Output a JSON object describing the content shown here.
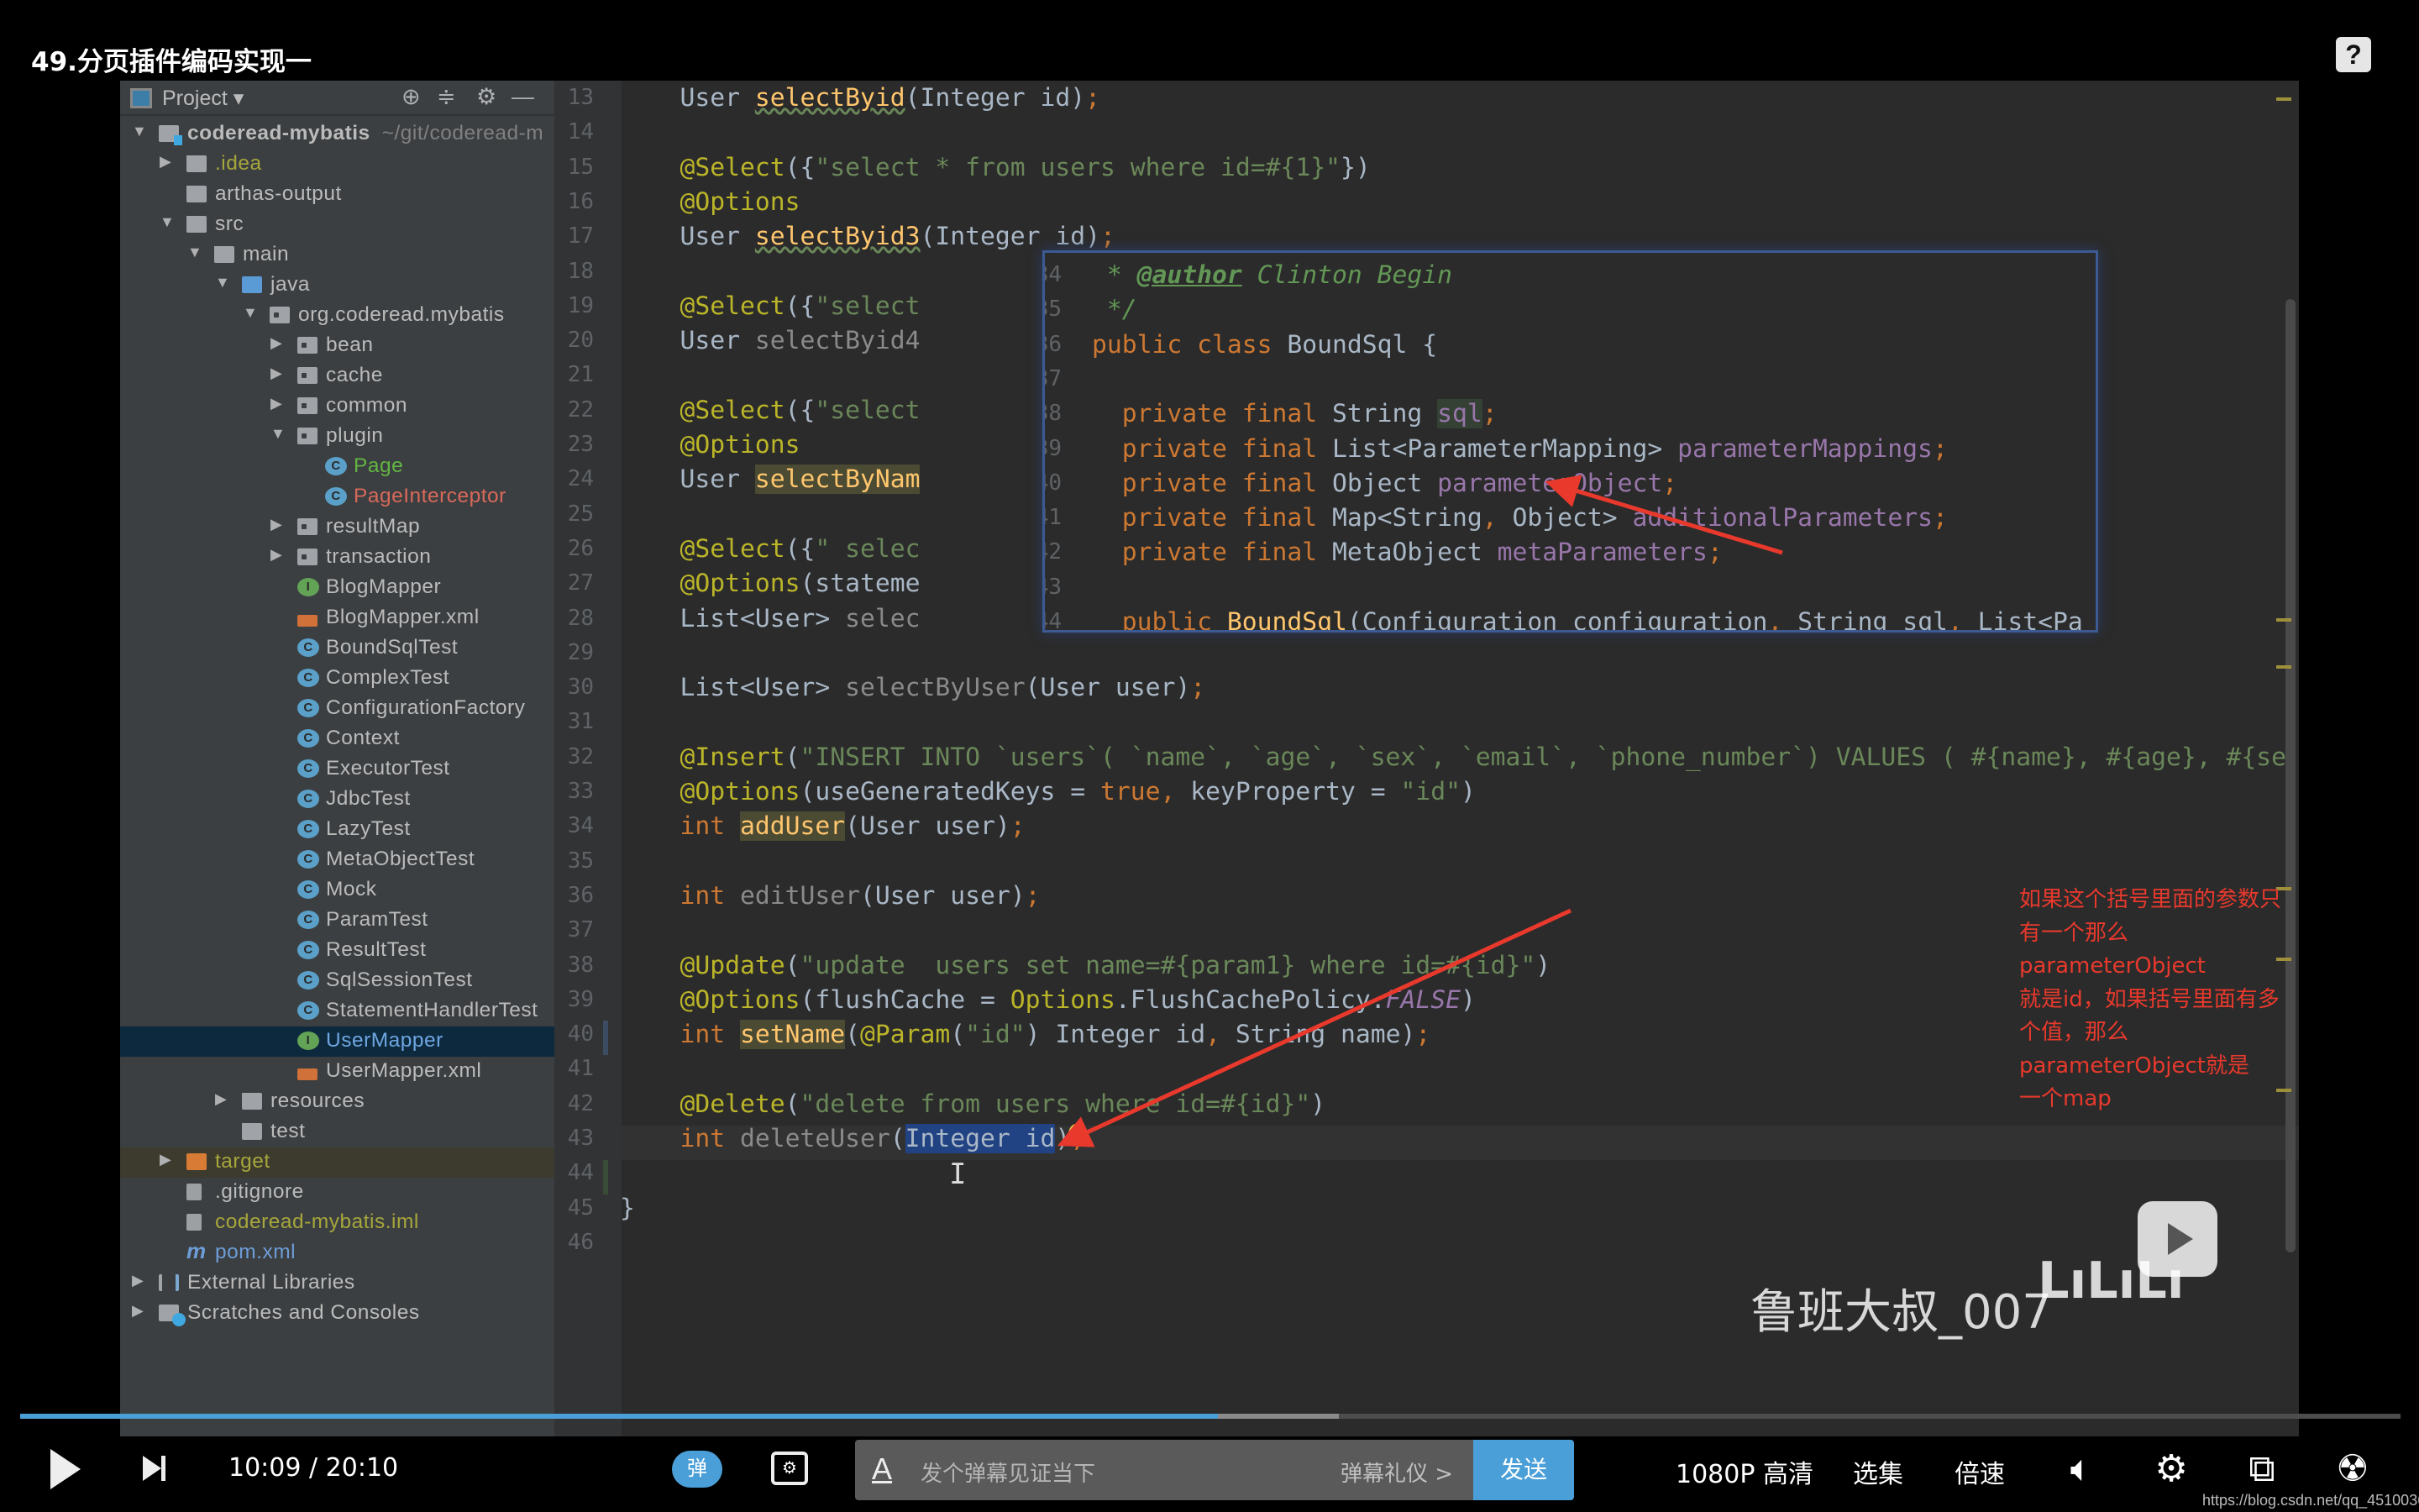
{
  "video_title": "49.分页插件编码实现一",
  "help_icon": "?",
  "sidebar": {
    "header": "Project",
    "header_icons": [
      "locate-icon",
      "collapse-icon",
      "gear-icon",
      "minimize-icon"
    ],
    "items": [
      {
        "label": "coderead-mybatis",
        "hint": "~/git/coderead-m",
        "level": 0,
        "arrow": "down",
        "icon": "module",
        "bold": true
      },
      {
        "label": ".idea",
        "level": 1,
        "arrow": "right",
        "icon": "folder",
        "color": "#a6a63c"
      },
      {
        "label": "arthas-output",
        "level": 1,
        "arrow": "",
        "icon": "folder"
      },
      {
        "label": "src",
        "level": 1,
        "arrow": "down",
        "icon": "folder"
      },
      {
        "label": "main",
        "level": 2,
        "arrow": "down",
        "icon": "folder"
      },
      {
        "label": "java",
        "level": 3,
        "arrow": "down",
        "icon": "folder-blue"
      },
      {
        "label": "org.coderead.mybatis",
        "level": 4,
        "arrow": "down",
        "icon": "package"
      },
      {
        "label": "bean",
        "level": 5,
        "arrow": "right",
        "icon": "package"
      },
      {
        "label": "cache",
        "level": 5,
        "arrow": "right",
        "icon": "package"
      },
      {
        "label": "common",
        "level": 5,
        "arrow": "right",
        "icon": "package"
      },
      {
        "label": "plugin",
        "level": 5,
        "arrow": "down",
        "icon": "package"
      },
      {
        "label": "Page",
        "level": 6,
        "arrow": "",
        "icon": "class",
        "color": "#62b543"
      },
      {
        "label": "PageInterceptor",
        "level": 6,
        "arrow": "",
        "icon": "class",
        "color": "#d8695a"
      },
      {
        "label": "resultMap",
        "level": 5,
        "arrow": "right",
        "icon": "package"
      },
      {
        "label": "transaction",
        "level": 5,
        "arrow": "right",
        "icon": "package"
      },
      {
        "label": "BlogMapper",
        "level": 5,
        "arrow": "",
        "icon": "iface"
      },
      {
        "label": "BlogMapper.xml",
        "level": 5,
        "arrow": "",
        "icon": "xml"
      },
      {
        "label": "BoundSqlTest",
        "level": 5,
        "arrow": "",
        "icon": "test"
      },
      {
        "label": "ComplexTest",
        "level": 5,
        "arrow": "",
        "icon": "test"
      },
      {
        "label": "ConfigurationFactory",
        "level": 5,
        "arrow": "",
        "icon": "class"
      },
      {
        "label": "Context",
        "level": 5,
        "arrow": "",
        "icon": "test"
      },
      {
        "label": "ExecutorTest",
        "level": 5,
        "arrow": "",
        "icon": "test"
      },
      {
        "label": "JdbcTest",
        "level": 5,
        "arrow": "",
        "icon": "test"
      },
      {
        "label": "LazyTest",
        "level": 5,
        "arrow": "",
        "icon": "test"
      },
      {
        "label": "MetaObjectTest",
        "level": 5,
        "arrow": "",
        "icon": "test"
      },
      {
        "label": "Mock",
        "level": 5,
        "arrow": "",
        "icon": "class"
      },
      {
        "label": "ParamTest",
        "level": 5,
        "arrow": "",
        "icon": "test"
      },
      {
        "label": "ResultTest",
        "level": 5,
        "arrow": "",
        "icon": "test"
      },
      {
        "label": "SqlSessionTest",
        "level": 5,
        "arrow": "",
        "icon": "class"
      },
      {
        "label": "StatementHandlerTest",
        "level": 5,
        "arrow": "",
        "icon": "test"
      },
      {
        "label": "UserMapper",
        "level": 5,
        "arrow": "",
        "icon": "iface",
        "color": "#6ea6e0",
        "selected": true
      },
      {
        "label": "UserMapper.xml",
        "level": 5,
        "arrow": "",
        "icon": "xml"
      },
      {
        "label": "resources",
        "level": 3,
        "arrow": "right",
        "icon": "folder"
      },
      {
        "label": "test",
        "level": 3,
        "arrow": "",
        "icon": "folder"
      },
      {
        "label": "target",
        "level": 1,
        "arrow": "right",
        "icon": "folder-orange",
        "color": "#a6a63c",
        "excluded": true
      },
      {
        "label": ".gitignore",
        "level": 1,
        "arrow": "",
        "icon": "file"
      },
      {
        "label": "coderead-mybatis.iml",
        "level": 1,
        "arrow": "",
        "icon": "file",
        "color": "#a6a63c"
      },
      {
        "label": "pom.xml",
        "level": 1,
        "arrow": "",
        "icon": "maven",
        "color": "#6d9dd8"
      },
      {
        "label": "External Libraries",
        "level": 0,
        "arrow": "right",
        "icon": "libs"
      },
      {
        "label": "Scratches and Consoles",
        "level": 0,
        "arrow": "right",
        "icon": "scratch"
      }
    ]
  },
  "editor": {
    "first_line": 13,
    "current_line": 43,
    "lines": [
      [
        [
          "    User ",
          "d"
        ],
        [
          "selectByid",
          "w"
        ],
        [
          "(Integer id)",
          "d"
        ],
        [
          ";",
          "k"
        ]
      ],
      [],
      [
        [
          "    ",
          "d"
        ],
        [
          "@Select",
          "a"
        ],
        [
          "({",
          "d"
        ],
        [
          "\"select * from users where id=#{1}\"",
          "s"
        ],
        [
          "})",
          "d"
        ]
      ],
      [
        [
          "    ",
          "d"
        ],
        [
          "@Options",
          "a"
        ]
      ],
      [
        [
          "    User ",
          "d"
        ],
        [
          "selectByid3",
          "w"
        ],
        [
          "(Integer id)",
          "d"
        ],
        [
          ";",
          "k"
        ]
      ],
      [],
      [
        [
          "    ",
          "d"
        ],
        [
          "@Select",
          "a"
        ],
        [
          "({",
          "d"
        ],
        [
          "\"select",
          "s"
        ]
      ],
      [
        [
          "    User ",
          "d"
        ],
        [
          "selectByid4",
          "u"
        ]
      ],
      [],
      [
        [
          "    ",
          "d"
        ],
        [
          "@Select",
          "a"
        ],
        [
          "({",
          "d"
        ],
        [
          "\"select",
          "s"
        ]
      ],
      [
        [
          "    ",
          "d"
        ],
        [
          "@Options",
          "a"
        ]
      ],
      [
        [
          "    User ",
          "d"
        ],
        [
          "selectByNam",
          "h"
        ]
      ],
      [],
      [
        [
          "    ",
          "d"
        ],
        [
          "@Select",
          "a"
        ],
        [
          "({",
          "d"
        ],
        [
          "\" selec",
          "s"
        ]
      ],
      [
        [
          "    ",
          "d"
        ],
        [
          "@Options",
          "a"
        ],
        [
          "(stateme",
          "d"
        ]
      ],
      [
        [
          "    List<User> ",
          "d"
        ],
        [
          "selec",
          "u"
        ]
      ],
      [],
      [
        [
          "    List<User> ",
          "d"
        ],
        [
          "selectByUser",
          "u"
        ],
        [
          "(User user)",
          "d"
        ],
        [
          ";",
          "k"
        ]
      ],
      [],
      [
        [
          "    ",
          "d"
        ],
        [
          "@Insert",
          "a"
        ],
        [
          "(",
          "d"
        ],
        [
          "\"INSERT INTO `users`( `name`, `age`, `sex`, `email`, `phone_number`) VALUES ( #{name}, #{age}, #{se",
          "s"
        ]
      ],
      [
        [
          "    ",
          "d"
        ],
        [
          "@Options",
          "a"
        ],
        [
          "(useGeneratedKeys = ",
          "d"
        ],
        [
          "true",
          "k"
        ],
        [
          ", ",
          "k"
        ],
        [
          "keyProperty = ",
          "d"
        ],
        [
          "\"id\"",
          "s"
        ],
        [
          ")",
          "d"
        ]
      ],
      [
        [
          "    ",
          "d"
        ],
        [
          "int",
          "k"
        ],
        [
          " ",
          "d"
        ],
        [
          "addUser",
          "h"
        ],
        [
          "(User user)",
          "d"
        ],
        [
          ";",
          "k"
        ]
      ],
      [],
      [
        [
          "    ",
          "d"
        ],
        [
          "int",
          "k"
        ],
        [
          " editUser",
          "u"
        ],
        [
          "(User user)",
          "d"
        ],
        [
          ";",
          "k"
        ]
      ],
      [],
      [
        [
          "    ",
          "d"
        ],
        [
          "@Update",
          "a"
        ],
        [
          "(",
          "d"
        ],
        [
          "\"update  users set name=#{param1} where id=#{id}\"",
          "s"
        ],
        [
          ")",
          "d"
        ]
      ],
      [
        [
          "    ",
          "d"
        ],
        [
          "@Options",
          "a"
        ],
        [
          "(flushCache = ",
          "d"
        ],
        [
          "Options",
          "a"
        ],
        [
          ".FlushCachePolicy.",
          "d"
        ],
        [
          "FALSE",
          "i"
        ],
        [
          ")",
          "d"
        ]
      ],
      [
        [
          "    ",
          "d"
        ],
        [
          "int",
          "k"
        ],
        [
          " ",
          "d"
        ],
        [
          "setName",
          "h"
        ],
        [
          "(",
          "d"
        ],
        [
          "@Param",
          "a"
        ],
        [
          "(",
          "d"
        ],
        [
          "\"id\"",
          "s"
        ],
        [
          ") Integer id",
          "d"
        ],
        [
          ", ",
          "k"
        ],
        [
          "String name)",
          "d"
        ],
        [
          ";",
          "k"
        ]
      ],
      [],
      [
        [
          "    ",
          "d"
        ],
        [
          "@Delete",
          "a"
        ],
        [
          "(",
          "d"
        ],
        [
          "\"delete from users where id=#{id}\"",
          "s"
        ],
        [
          ")",
          "d"
        ]
      ],
      [
        [
          "    ",
          "d"
        ],
        [
          "int",
          "k"
        ],
        [
          " deleteUser",
          "u"
        ],
        [
          "(",
          "d"
        ],
        [
          "Integer id",
          "sel"
        ],
        [
          ")",
          "d"
        ],
        [
          ";",
          "k"
        ]
      ],
      [],
      [
        [
          "}",
          "d"
        ]
      ],
      []
    ]
  },
  "popup": {
    "first_line": 34,
    "lines": [
      [
        [
          " * ",
          "c"
        ],
        [
          "@author",
          "ct"
        ],
        [
          " Clinton Begin",
          "c"
        ]
      ],
      [
        [
          " */",
          "c"
        ]
      ],
      [
        [
          "public class ",
          "k"
        ],
        [
          "BoundSql {",
          "d"
        ]
      ],
      [],
      [
        [
          "  private final ",
          "k"
        ],
        [
          "String ",
          "d"
        ],
        [
          "sql",
          "fh"
        ],
        [
          ";",
          "k"
        ]
      ],
      [
        [
          "  private final ",
          "k"
        ],
        [
          "List<ParameterMapping> ",
          "d"
        ],
        [
          "parameterMappings",
          "f"
        ],
        [
          ";",
          "k"
        ]
      ],
      [
        [
          "  private final ",
          "k"
        ],
        [
          "Object ",
          "d"
        ],
        [
          "parameterObject",
          "f"
        ],
        [
          ";",
          "k"
        ]
      ],
      [
        [
          "  private final ",
          "k"
        ],
        [
          "Map<String",
          "d"
        ],
        [
          ", ",
          "k"
        ],
        [
          "Object> ",
          "d"
        ],
        [
          "additionalParameters",
          "f"
        ],
        [
          ";",
          "k"
        ]
      ],
      [
        [
          "  private final ",
          "k"
        ],
        [
          "MetaObject ",
          "d"
        ],
        [
          "metaParameters",
          "f"
        ],
        [
          ";",
          "k"
        ]
      ],
      [],
      [
        [
          "  public ",
          "k"
        ],
        [
          "BoundSql",
          "m"
        ],
        [
          "(Configuration configuration",
          "d"
        ],
        [
          ", ",
          "k"
        ],
        [
          "String sql",
          "d"
        ],
        [
          ", ",
          "k"
        ],
        [
          "List<Pa",
          "d"
        ]
      ]
    ]
  },
  "annotation": {
    "lines": [
      "如果这个括号里面的参数只有一个那么parameterObject",
      "就是id，如果括号里面有多个值，那么parameterObject就是",
      "一个map"
    ],
    "color": "#e8392c"
  },
  "watermark": {
    "uploader": "鲁班大叔_007",
    "logo": "bilibili"
  },
  "player": {
    "current_time": "10:09",
    "separator": "/",
    "duration": "20:10",
    "progress_percent": 50.3,
    "buffered_percent": 55.4,
    "danmaku_toggle": "弹",
    "danmaku_placeholder": "发个弹幕见证当下",
    "danmaku_etiquette": "弹幕礼仪 >",
    "send_label": "发送",
    "quality": "1080P 高清",
    "episodes": "选集",
    "speed": "倍速",
    "accent": "#4a9fd8"
  },
  "csdn_watermark": "https://blog.csdn.net/qq_45100361"
}
